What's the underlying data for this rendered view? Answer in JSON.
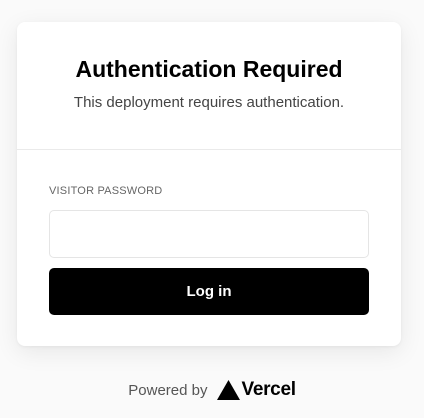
{
  "card": {
    "title": "Authentication Required",
    "subtitle": "This deployment requires authentication."
  },
  "form": {
    "password_label": "VISITOR PASSWORD",
    "password_value": "",
    "password_placeholder": "",
    "login_button_label": "Log in"
  },
  "footer": {
    "powered_by": "Powered by",
    "brand": "Vercel",
    "brand_icon": "vercel-triangle-icon"
  },
  "colors": {
    "button_background": "#000000",
    "button_text": "#ffffff",
    "page_background": "#fafafa",
    "card_background": "#ffffff"
  }
}
